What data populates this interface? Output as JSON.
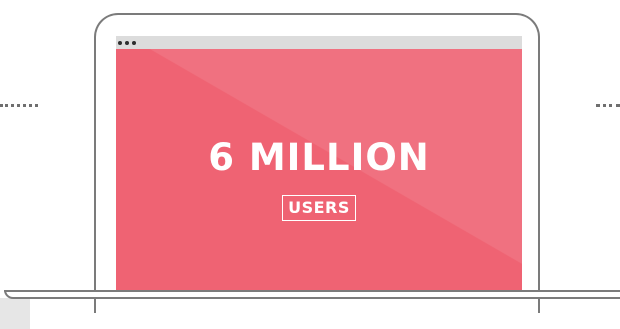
{
  "screen": {
    "headline": "6 MILLION",
    "badge": "USERS"
  },
  "colors": {
    "screen_background": "#ef6373",
    "outline": "#7b7b7b",
    "text": "#ffffff"
  },
  "icons": {
    "window_controls": "three-dots-icon"
  }
}
